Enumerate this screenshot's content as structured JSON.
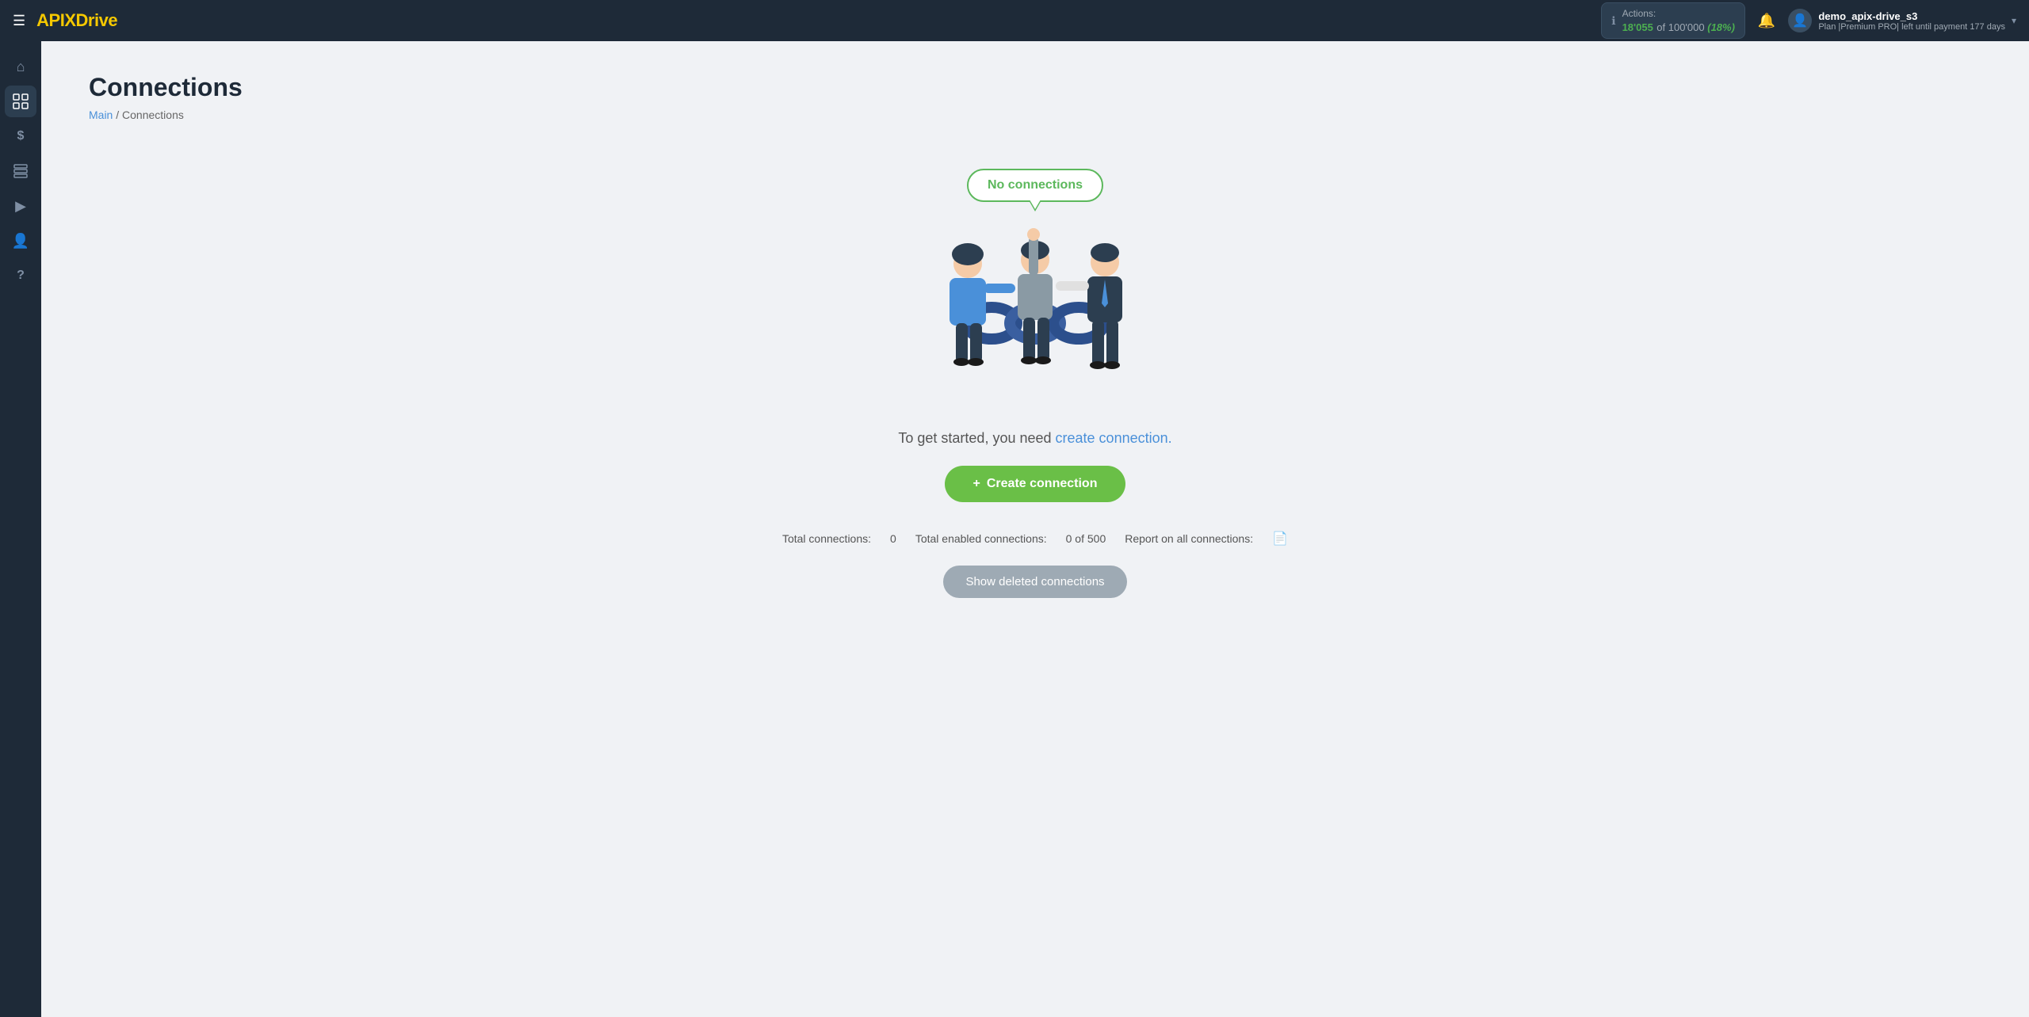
{
  "topbar": {
    "menu_icon": "☰",
    "logo_prefix": "API",
    "logo_x": "X",
    "logo_suffix": "Drive",
    "actions_label": "Actions:",
    "actions_count": "18'055",
    "actions_total": "of 100'000",
    "actions_percent": "(18%)",
    "bell_icon": "🔔",
    "user_name": "demo_apix-drive_s3",
    "plan_label": "Plan |Premium PRO| left until payment",
    "days_left": "177 days",
    "chevron": "▾"
  },
  "sidebar": {
    "items": [
      {
        "id": "home",
        "icon": "⌂",
        "label": "Home"
      },
      {
        "id": "connections",
        "icon": "⊞",
        "label": "Connections",
        "active": true
      },
      {
        "id": "billing",
        "icon": "$",
        "label": "Billing"
      },
      {
        "id": "tools",
        "icon": "⊡",
        "label": "Tools"
      },
      {
        "id": "video",
        "icon": "▶",
        "label": "Video"
      },
      {
        "id": "profile",
        "icon": "👤",
        "label": "Profile"
      },
      {
        "id": "help",
        "icon": "?",
        "label": "Help"
      }
    ]
  },
  "page": {
    "title": "Connections",
    "breadcrumb_main": "Main",
    "breadcrumb_separator": "/",
    "breadcrumb_current": "Connections"
  },
  "empty_state": {
    "cloud_label": "No connections",
    "start_text_static": "To get started, you need",
    "start_text_link": "create connection.",
    "create_btn_plus": "+",
    "create_btn_label": "Create connection",
    "total_connections_label": "Total connections:",
    "total_connections_value": "0",
    "total_enabled_label": "Total enabled connections:",
    "total_enabled_value": "0 of 500",
    "report_label": "Report on all connections:",
    "report_icon": "📄",
    "show_deleted_label": "Show deleted connections"
  }
}
